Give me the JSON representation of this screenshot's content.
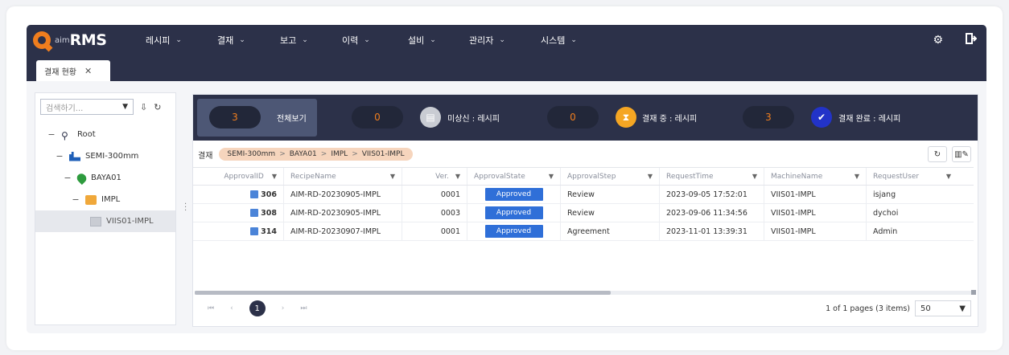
{
  "app": {
    "logo_small": "aim",
    "logo_big": "RMS"
  },
  "menu": [
    {
      "label": "레시피"
    },
    {
      "label": "결재"
    },
    {
      "label": "보고"
    },
    {
      "label": "이력"
    },
    {
      "label": "설비"
    },
    {
      "label": "관리자"
    },
    {
      "label": "시스템"
    }
  ],
  "tabs": [
    {
      "label": "결재 현황"
    }
  ],
  "tree": {
    "search_placeholder": "검색하기...",
    "nodes": [
      {
        "label": "Root",
        "toggle": "−"
      },
      {
        "label": "SEMI-300mm",
        "toggle": "−"
      },
      {
        "label": "BAYA01",
        "toggle": "−"
      },
      {
        "label": "IMPL",
        "toggle": "−"
      },
      {
        "label": "VIIS01-IMPL",
        "toggle": ""
      }
    ]
  },
  "stats": [
    {
      "count": "3",
      "label": "전체보기"
    },
    {
      "count": "0",
      "label": "미상신 : 레시피",
      "icon_color": "#c9ccd3"
    },
    {
      "count": "0",
      "label": "결재 중 : 레시피",
      "icon_color": "#f5a623"
    },
    {
      "count": "3",
      "label": "결재 완료 : 레시피",
      "icon_color": "#2233c8"
    }
  ],
  "breadcrumb": {
    "title": "결재",
    "path": [
      "SEMI-300mm",
      "BAYA01",
      "IMPL",
      "VIIS01-IMPL"
    ],
    "separator": ">"
  },
  "grid": {
    "columns": [
      "ApprovalID",
      "RecipeName",
      "Ver.",
      "ApprovalState",
      "ApprovalStep",
      "RequestTime",
      "MachineName",
      "RequestUser"
    ],
    "rows": [
      {
        "id": "306",
        "recipe": "AIM-RD-20230905-IMPL",
        "ver": "0001",
        "state": "Approved",
        "step": "Review",
        "time": "2023-09-05 17:52:01",
        "machine": "VIIS01-IMPL",
        "user": "isjang"
      },
      {
        "id": "308",
        "recipe": "AIM-RD-20230905-IMPL",
        "ver": "0003",
        "state": "Approved",
        "step": "Review",
        "time": "2023-09-06 11:34:56",
        "machine": "VIIS01-IMPL",
        "user": "dychoi"
      },
      {
        "id": "314",
        "recipe": "AIM-RD-20230907-IMPL",
        "ver": "0001",
        "state": "Approved",
        "step": "Agreement",
        "time": "2023-11-01 13:39:31",
        "machine": "VIIS01-IMPL",
        "user": "Admin"
      }
    ]
  },
  "pager": {
    "first": "⏮",
    "prev": "‹",
    "current": "1",
    "next": "›",
    "last": "⏭",
    "info": "1 of 1 pages (3 items)",
    "page_size": "50"
  },
  "colors": {
    "nav_bg": "#2c3149",
    "accent_orange": "#f07e1e",
    "approved_badge": "#2f6fd8",
    "breadcrumb_bg": "#f6d5bd"
  }
}
